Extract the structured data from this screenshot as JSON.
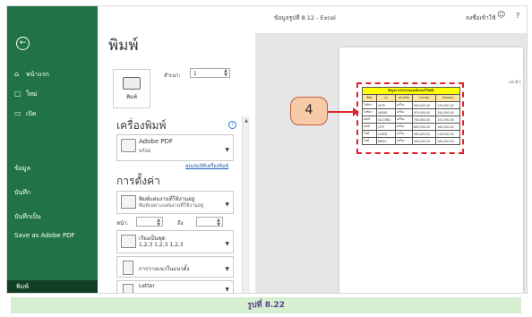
{
  "window": {
    "file_title": "ข้อมูลรูปที่ 8.12 - Excel",
    "account": "ลงชื่อเข้าใช้",
    "help": "?",
    "face_icon": "smiley-icon"
  },
  "sidebar": {
    "back_icon": "back-arrow-icon",
    "items": [
      {
        "label": "หน้าแรก",
        "icon": "home-icon"
      },
      {
        "label": "ใหม่",
        "icon": "new-document-icon"
      },
      {
        "label": "เปิด",
        "icon": "folder-open-icon"
      },
      {
        "label": "ข้อมูล"
      },
      {
        "label": "บันทึก"
      },
      {
        "label": "บันทึกเป็น"
      },
      {
        "label": "Save as Adobe PDF"
      }
    ],
    "selected": "พิมพ์"
  },
  "print": {
    "title": "พิมพ์",
    "button_label": "พิมพ์",
    "copies_label": "สำเนา:",
    "copies_value": "1"
  },
  "printer": {
    "section_title": "เครื่องพิมพ์",
    "name": "Adobe PDF",
    "status": "พร้อม",
    "properties_link": "คุณสมบัติเครื่องพิมพ์"
  },
  "settings": {
    "section_title": "การตั้งค่า",
    "print_what_main": "พิมพ์แผ่นงานที่ใช้งานอยู่",
    "print_what_sub": "พิมพ์เฉพาะแผ่นงานที่ใช้งานอยู่",
    "pages_label": "หน้า:",
    "to_label": "ถึง",
    "collate_main": "เรียงเป็นชุด",
    "collate_sub": "1,2,3   1,2,3   1,2,3",
    "orientation": "การวางแนวในแนวตั้ง",
    "paper": "Letter"
  },
  "preview": {
    "page_number": "หน้าที่ 1",
    "callout_number": "4",
    "table_caption": "ข้อมูลการจำหน่ายคอมพิวเตอร์โน้ตบุ๊ก",
    "headers": [
      "ยี่ห้อ",
      "รุ่น",
      "หน่วยนับ",
      "ราคาทุน",
      "เงินลงทุน"
    ],
    "rows": [
      [
        "โตชิบา",
        "ULTR",
        "เครื่อง",
        "900,000.00",
        "130,000.00"
      ],
      [
        "โตชิบา",
        "UAR61",
        "เครื่อง",
        "970,000.00",
        "194,000.00"
      ],
      [
        "เดลล์",
        "ACCORD",
        "เครื่อง",
        "760,000.00",
        "152,000.00"
      ],
      [
        "เดลล์",
        "CITY",
        "เครื่อง",
        "800,000.00",
        "160,000.00"
      ],
      [
        "โซนี่",
        "LUXER",
        "เครื่อง",
        "580,000.00",
        "116,000.00"
      ],
      [
        "โซนี่",
        "BIRSO",
        "เครื่อง",
        "900,000.00",
        "180,000.00"
      ]
    ]
  },
  "caption": "รูปที่ 8.22",
  "colors": {
    "sidebar": "#217346",
    "callout_fill": "#f8cba8",
    "highlight": "#e0222a",
    "caption_bg": "#d6efd1"
  }
}
